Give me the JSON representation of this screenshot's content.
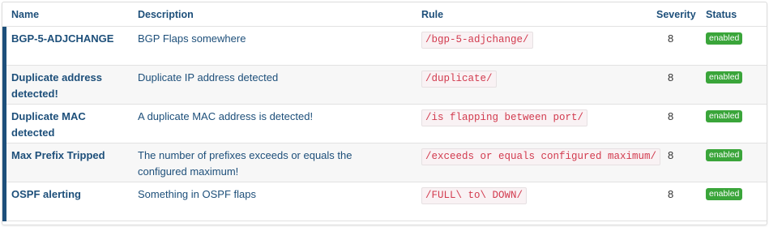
{
  "table": {
    "headers": {
      "name": "Name",
      "description": "Description",
      "rule": "Rule",
      "severity": "Severity",
      "status": "Status"
    },
    "rows": [
      {
        "name": "BGP-5-ADJCHANGE",
        "description": "BGP Flaps somewhere",
        "rule": "/bgp-5-adjchange/",
        "severity": "8",
        "status": "enabled"
      },
      {
        "name": "Duplicate address detected!",
        "description": "Duplicate IP address detected",
        "rule": "/duplicate/",
        "severity": "8",
        "status": "enabled"
      },
      {
        "name": "Duplicate MAC detected",
        "description": "A duplicate MAC address is detected!",
        "rule": "/is flapping between port/",
        "severity": "8",
        "status": "enabled"
      },
      {
        "name": "Max Prefix Tripped",
        "description": "The number of prefixes exceeds or equals the configured maximum!",
        "rule": "/exceeds or equals configured maximum/",
        "severity": "8",
        "status": "enabled"
      },
      {
        "name": "OSPF alerting",
        "description": "Something in OSPF flaps",
        "rule": "/FULL\\ to\\ DOWN/",
        "severity": "8",
        "status": "enabled"
      }
    ]
  },
  "icons": {
    "edit": "gear-icon",
    "delete": "trash-icon"
  },
  "colors": {
    "accent": "#1d4f7a",
    "status_enabled": "#3aa53a",
    "rule_text": "#d23a4e",
    "delete": "#c0392b",
    "gear": "#777777"
  }
}
